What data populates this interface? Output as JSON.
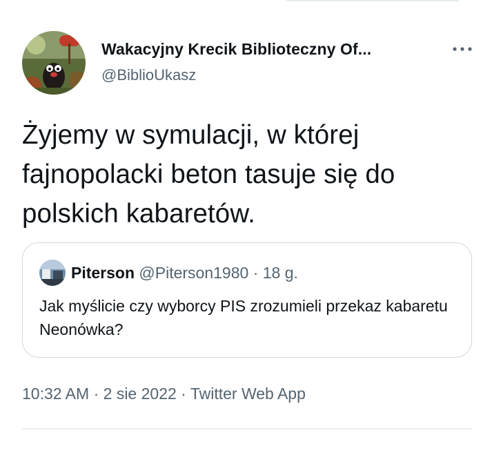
{
  "tweet": {
    "author_name": "Wakacyjny Krecik Biblioteczny Of...",
    "author_handle": "@BiblioUkasz",
    "text": "Żyjemy w symulacji, w której fajnopolacki beton tasuje się do polskich kabaretów.",
    "more_icon": "more-horizontal-icon"
  },
  "quoted_tweet": {
    "author_name": "Piterson",
    "meta": "@Piterson1980 · 18 g.",
    "text": "Jak myślicie czy wyborcy PIS zrozumieli przekaz kabaretu Neonówka?"
  },
  "footer": {
    "time": "10:32 AM",
    "date": "2 sie 2022",
    "source": "Twitter Web App",
    "separator": "·"
  },
  "colors": {
    "text_primary": "#0f1419",
    "text_secondary": "#536471",
    "border": "#cfd9de",
    "divider": "#e6ecf0"
  }
}
